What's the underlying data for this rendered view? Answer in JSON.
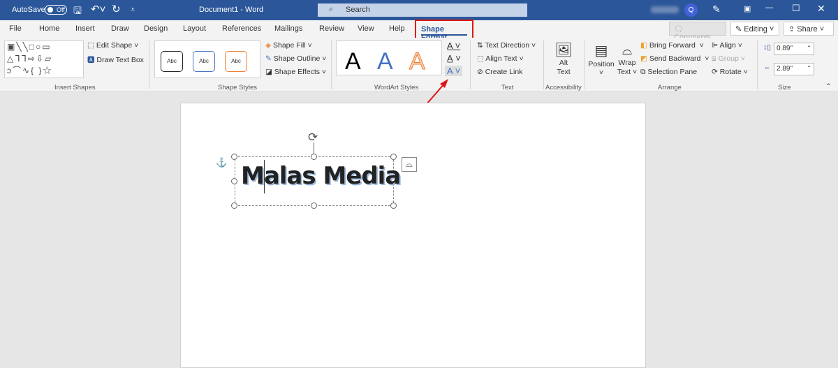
{
  "titlebar": {
    "autosave_label": "AutoSave",
    "autosave_state": "Off",
    "document_title": "Document1  -  Word",
    "search_placeholder": "Search",
    "user_initial": "Q"
  },
  "tabs": [
    "File",
    "Home",
    "Insert",
    "Draw",
    "Design",
    "Layout",
    "References",
    "Mailings",
    "Review",
    "View",
    "Help"
  ],
  "active_tab": "Shape Format",
  "right_buttons": {
    "comments": "Comments",
    "editing": "Editing",
    "share": "Share"
  },
  "groups": {
    "insert_shapes": {
      "label": "Insert Shapes",
      "edit_shape": "Edit Shape",
      "draw_text_box": "Draw Text Box"
    },
    "shape_styles": {
      "label": "Shape Styles",
      "presets": [
        "Abc",
        "Abc",
        "Abc"
      ],
      "fill": "Shape Fill",
      "outline": "Shape Outline",
      "effects": "Shape Effects"
    },
    "wordart_styles": {
      "label": "WordArt Styles",
      "presets": [
        "A",
        "A",
        "A"
      ]
    },
    "text": {
      "label": "Text",
      "direction": "Text Direction",
      "align": "Align Text",
      "link": "Create Link"
    },
    "accessibility": {
      "label": "Accessibility",
      "alt_text": "Alt Text"
    },
    "arrange": {
      "label": "Arrange",
      "position": "Position",
      "wrap": "Wrap Text",
      "bring_forward": "Bring Forward",
      "send_backward": "Send Backward",
      "selection_pane": "Selection Pane",
      "align": "Align",
      "group": "Group",
      "rotate": "Rotate"
    },
    "size": {
      "label": "Size",
      "height": "0.89\"",
      "width": "2.89\""
    }
  },
  "document": {
    "wordart_text": "Malas Media"
  },
  "colors": {
    "titlebar": "#2b579a",
    "highlight": "#e01515",
    "wordart_shadow": "#9cb8db"
  }
}
